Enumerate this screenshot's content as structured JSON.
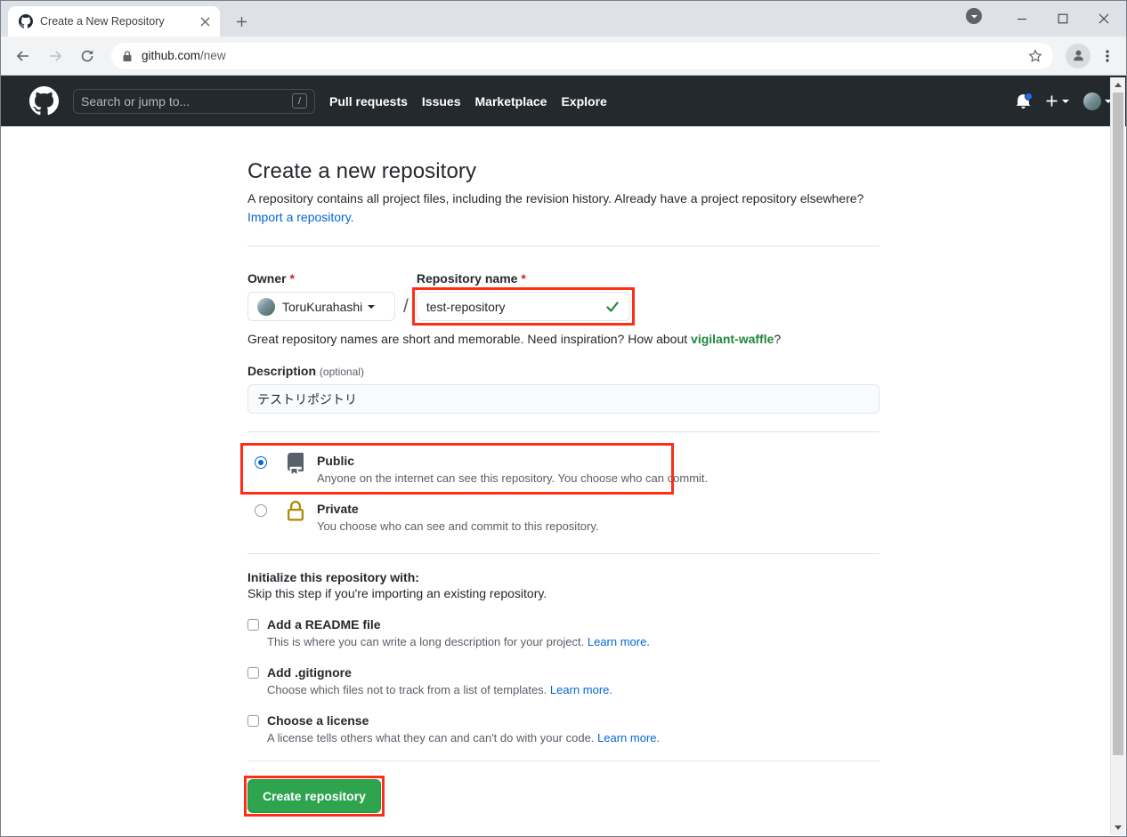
{
  "browser": {
    "tab": {
      "title": "Create a New Repository",
      "favicon": "github-icon",
      "close": "close-icon"
    },
    "new_tab_label": "+",
    "update_indicator": "update-chevron-icon",
    "window_controls": {
      "minimize": "—",
      "maximize": "□",
      "close": "✕"
    },
    "nav": {
      "back": "back-arrow-icon",
      "forward": "forward-arrow-icon",
      "reload": "reload-icon"
    },
    "omnibox": {
      "lock": "lock-icon",
      "host": "github.com",
      "path": "/new",
      "star": "star-icon"
    },
    "profile": "profile-avatar-icon",
    "menu": "three-dot-menu-icon"
  },
  "gh_header": {
    "logo": "github-mark-icon",
    "search_placeholder": "Search or jump to...",
    "search_key_hint": "/",
    "nav": [
      {
        "label": "Pull requests"
      },
      {
        "label": "Issues"
      },
      {
        "label": "Marketplace"
      },
      {
        "label": "Explore"
      }
    ],
    "notifications_icon": "bell-icon",
    "has_notification_dot": true,
    "create_new_icon": "plus-icon",
    "account_avatar": "user-avatar"
  },
  "main": {
    "title": "Create a new repository",
    "intro": "A repository contains all project files, including the revision history. Already have a project repository elsewhere?",
    "import_link": "Import a repository.",
    "owner": {
      "label": "Owner",
      "required_mark": "*",
      "value": "ToruKurahashi",
      "avatar": "owner-avatar"
    },
    "separator": "/",
    "repo_name": {
      "label": "Repository name",
      "required_mark": "*",
      "value": "test-repository",
      "valid_icon": "check-icon"
    },
    "hint": {
      "prefix": "Great repository names are short and memorable. Need inspiration? How about ",
      "suggestion": "vigilant-waffle",
      "suffix": "?"
    },
    "description": {
      "label": "Description",
      "optional": "(optional)",
      "value": "テストリポジトリ"
    },
    "visibility": [
      {
        "id": "public",
        "title": "Public",
        "desc": "Anyone on the internet can see this repository. You choose who can commit.",
        "icon": "repo-book-icon",
        "selected": true
      },
      {
        "id": "private",
        "title": "Private",
        "desc": "You choose who can see and commit to this repository.",
        "icon": "lock-icon",
        "selected": false
      }
    ],
    "initialize": {
      "title": "Initialize this repository with:",
      "subtitle": "Skip this step if you're importing an existing repository.",
      "options": [
        {
          "label": "Add a README file",
          "desc": "This is where you can write a long description for your project. ",
          "link": "Learn more.",
          "checked": false
        },
        {
          "label": "Add .gitignore",
          "desc": "Choose which files not to track from a list of templates. ",
          "link": "Learn more.",
          "checked": false
        },
        {
          "label": "Choose a license",
          "desc": "A license tells others what they can and can't do with your code. ",
          "link": "Learn more.",
          "checked": false
        }
      ]
    },
    "submit_label": "Create repository"
  },
  "annotations": {
    "color": "#ff2d16",
    "targets": [
      "repository-name-field",
      "public-visibility-option",
      "create-repository-button"
    ]
  },
  "colors": {
    "gh_header_bg": "#24292e",
    "link": "#0366d6",
    "green_button": "#2ea44f",
    "success_green": "#22863a",
    "required_red": "#cb2431",
    "annotation_red": "#ff2d16"
  }
}
